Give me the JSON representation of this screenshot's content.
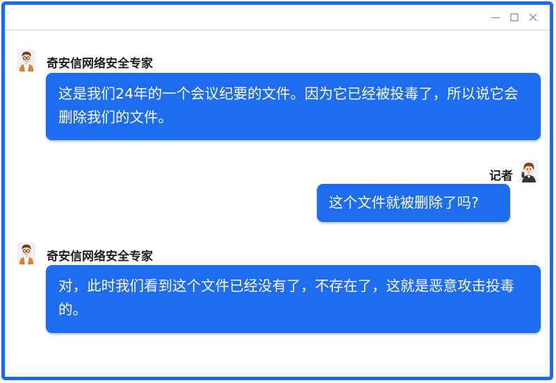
{
  "window": {
    "controls": {
      "minimize": "minimize-icon",
      "maximize": "maximize-icon",
      "close": "close-icon"
    }
  },
  "chat": {
    "messages": [
      {
        "sender": "奇安信网络安全专家",
        "side": "left",
        "text": "这是我们24年的一个会议纪要的文件。因为它已经被投毒了，所以说它会删除我们的文件。"
      },
      {
        "sender": "记者",
        "side": "right",
        "text": "这个文件就被删除了吗?"
      },
      {
        "sender": "奇安信网络安全专家",
        "side": "left",
        "text": "对，此时我们看到这个文件已经没有了，不存在了，这就是恶意攻击投毒的。"
      }
    ]
  },
  "colors": {
    "frame": "#1b6be8",
    "bubble": "#1e6cf0",
    "bubble_text": "#ffffff",
    "sender_text": "#1c1c1c"
  }
}
